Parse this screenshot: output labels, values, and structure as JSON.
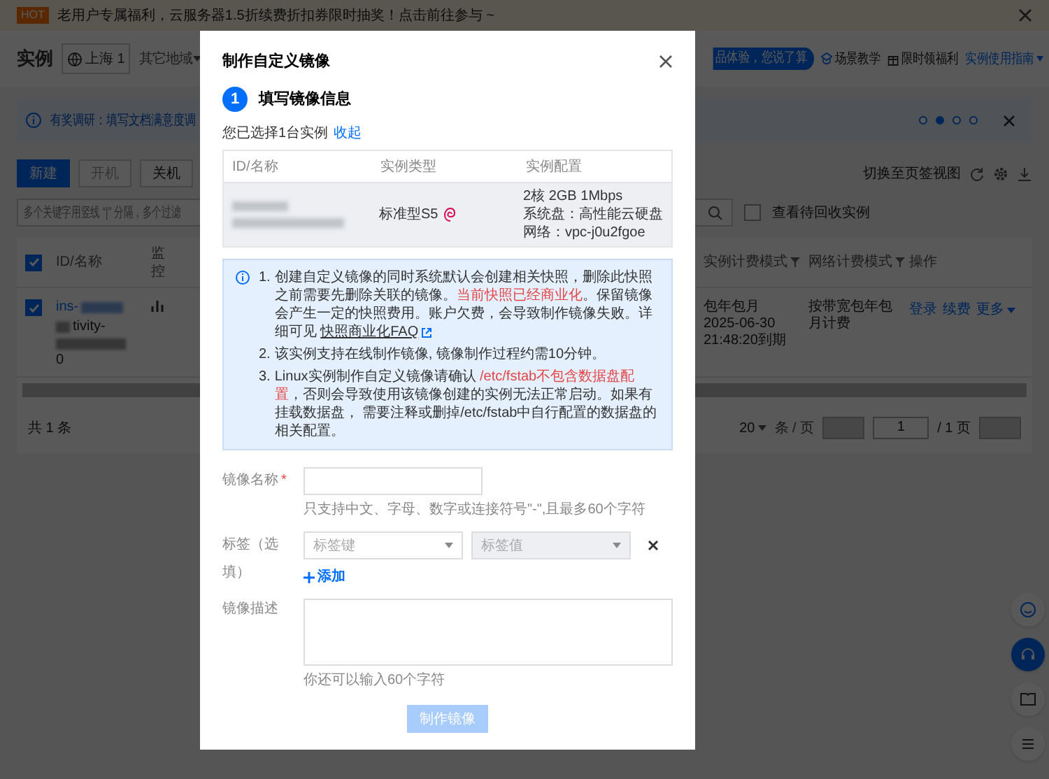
{
  "banner": {
    "badge": "HOT",
    "text": "老用户专属福利，云服务器1.5折续费折扣券限时抽奖！点击前往参与 ~"
  },
  "header": {
    "title": "实例",
    "region": "上海 1",
    "other_regions": "其它地域",
    "survey_pill": "品体验，您说了算",
    "links": [
      {
        "label": "场景教学",
        "kind": "course"
      },
      {
        "label": "限时领福利",
        "kind": "gift"
      },
      {
        "label": "实例使用指南",
        "kind": "guide"
      }
    ]
  },
  "notice": {
    "text": "有奖调研：填写文档满意度调",
    "dots": [
      {
        "selected": false
      },
      {
        "selected": true
      },
      {
        "selected": false
      },
      {
        "selected": false
      }
    ]
  },
  "toolbar": {
    "buttons": [
      {
        "label": "新建",
        "primary": true,
        "disabled": false
      },
      {
        "label": "开机",
        "primary": false,
        "disabled": true
      },
      {
        "label": "关机",
        "primary": false,
        "disabled": false
      }
    ],
    "view_switch": "切换至页签视图"
  },
  "search": {
    "placeholder": "多个关键字用竖线 “|” 分隔，多个过滤",
    "recycle": {
      "label": "查看待回收实例",
      "checked": false
    }
  },
  "table": {
    "all_checked": true,
    "columns": [
      {
        "label": "ID/名称"
      },
      {
        "label": "监控"
      },
      {
        "label": "实例计费模式"
      },
      {
        "label": "网络计费模式"
      },
      {
        "label": "操作"
      }
    ],
    "rows": [
      {
        "checked": true,
        "id": "ins-",
        "name": "tivity-",
        "extra": "0",
        "billing": [
          "包年包月",
          "2025-06-30",
          "21:48:20到期"
        ],
        "network_billing": "按带宽包年包月计费",
        "actions": [
          "登录",
          "续费",
          "更多"
        ]
      }
    ]
  },
  "footer": {
    "total": "共 1 条",
    "page_size": "20",
    "per_page": "条 / 页",
    "page": "1",
    "pages": "/ 1 页"
  },
  "modal": {
    "title": "制作自定义镜像",
    "step": {
      "number": "1",
      "label": "填写镜像信息"
    },
    "selected_text": "您已选择1台实例",
    "collapse_link": "收起",
    "instance_table": {
      "columns": [
        "ID/名称",
        "实例类型",
        "实例配置"
      ],
      "type": "标准型S5",
      "config": [
        "2核 2GB 1Mbps",
        "系统盘：高性能云硬盘",
        "网络：vpc-j0u2fgoe"
      ]
    },
    "notes": [
      {
        "number": "1.",
        "segments": [
          {
            "kind": "normal",
            "text": "创建自定义镜像的同时系统默认会创建相关快照，删除此快照之前需要先删除关联的镜像。"
          },
          {
            "kind": "warning",
            "text": "当前快照已经商业化"
          },
          {
            "kind": "normal",
            "text": "。保留镜像会产生一定的快照费用。账户欠费，会导致制作镜像失败。详细可见 "
          },
          {
            "kind": "link",
            "text": "快照商业化FAQ"
          }
        ]
      },
      {
        "number": "2.",
        "segments": [
          {
            "kind": "normal",
            "text": "该实例支持在线制作镜像, 镜像制作过程约需10分钟。"
          }
        ]
      },
      {
        "number": "3.",
        "segments": [
          {
            "kind": "normal",
            "text": "Linux实例制作自定义镜像请确认 "
          },
          {
            "kind": "warning",
            "text": "/etc/fstab不包含数据盘配置"
          },
          {
            "kind": "normal",
            "text": "，否则会导致使用该镜像创建的实例无法正常启动。如果有挂载数据盘， 需要注释或删掉/etc/fstab中自行配置的数据盘的相关配置。"
          }
        ]
      }
    ],
    "name_field": {
      "label": "镜像名称",
      "required_mark": "*",
      "hint": "只支持中文、字母、数字或连接符号\"-\",且最多60个字符"
    },
    "tags": {
      "label": "标签（选填）",
      "key": {
        "placeholder": "标签键",
        "disabled": false
      },
      "value": {
        "placeholder": "标签值",
        "disabled": true
      },
      "add": "添加"
    },
    "description": {
      "label": "镜像描述",
      "counter": "你还可以输入60个字符"
    },
    "submit": {
      "label": "制作镜像",
      "disabled": true
    }
  }
}
